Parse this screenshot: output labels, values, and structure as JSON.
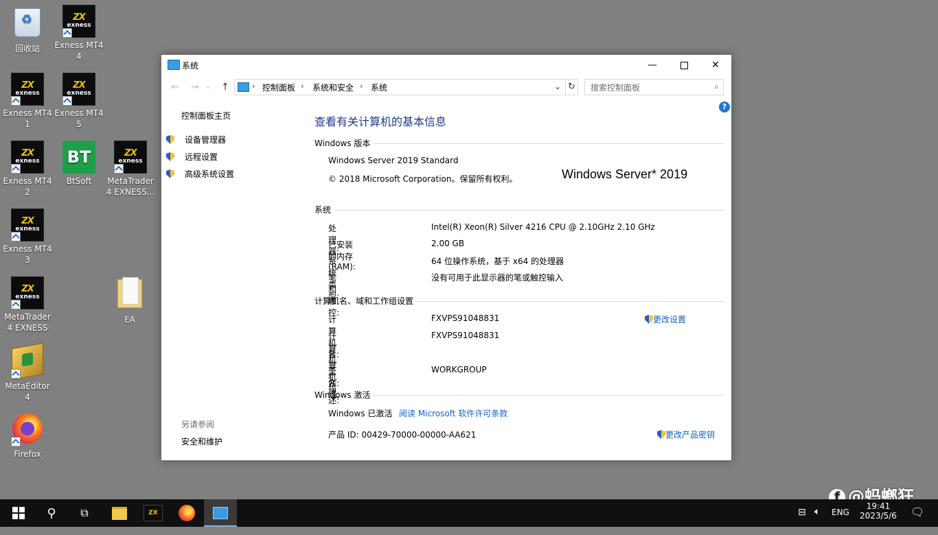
{
  "desktop": {
    "icons": [
      {
        "label": "回收站"
      },
      {
        "label": "Exness MT4 4"
      },
      {
        "label": "Exness MT4 1"
      },
      {
        "label": "Exness MT4 5"
      },
      {
        "label": "Exness MT4 2"
      },
      {
        "label": "BtSoft"
      },
      {
        "label": "MetaTrader 4 EXNESS..."
      },
      {
        "label": "Exness MT4 3"
      },
      {
        "label": "MetaTrader 4 EXNESS"
      },
      {
        "label": "EA"
      },
      {
        "label": "MetaEditor 4"
      },
      {
        "label": "Firefox"
      }
    ],
    "exness_logo_text": "exness",
    "exness_logo_mark": "ZX",
    "bt_logo_text": "BT"
  },
  "window": {
    "title": "系统",
    "controls": {
      "minimize": "—",
      "close": "✕"
    },
    "address": {
      "crumbs": [
        "控制面板",
        "系统和安全",
        "系统"
      ],
      "separator": "›",
      "search_placeholder": "搜索控制面板"
    },
    "help": "?",
    "left_nav": {
      "home": "控制面板主页",
      "items": [
        "设备管理器",
        "远程设置",
        "高级系统设置"
      ],
      "see_also": "另请参阅",
      "see_also_items": [
        "安全和维护"
      ]
    },
    "main": {
      "heading": "查看有关计算机的基本信息",
      "edition": {
        "header": "Windows 版本",
        "name": "Windows Server 2019 Standard",
        "copyright": "© 2018 Microsoft Corporation。保留所有权利。",
        "logo": "Windows Server* 2019"
      },
      "system": {
        "header": "系统",
        "rows": [
          {
            "k": "处理器:",
            "v": "Intel(R) Xeon(R) Silver 4216 CPU @ 2.10GHz   2.10 GHz"
          },
          {
            "k": "已安装的内存(RAM):",
            "v": "2.00 GB"
          },
          {
            "k": "系统类型:",
            "v": "64 位操作系统，基于 x64 的处理器"
          },
          {
            "k": "笔和触控:",
            "v": "没有可用于此显示器的笔或触控输入"
          }
        ]
      },
      "computer": {
        "header": "计算机名、域和工作组设置",
        "change_link": "更改设置",
        "rows": [
          {
            "k": "计算机名:",
            "v": "FXVPS91048831"
          },
          {
            "k": "计算机全名:",
            "v": "FXVPS91048831"
          },
          {
            "k": "计算机描述:",
            "v": ""
          },
          {
            "k": "工作组:",
            "v": "WORKGROUP"
          }
        ]
      },
      "activation": {
        "header": "Windows 激活",
        "status": "Windows 已激活",
        "license_link": "阅读 Microsoft 软件许可条款",
        "product_id": "产品 ID: 00429-70000-00000-AA621",
        "change_key_link": "更改产品密钥"
      }
    }
  },
  "taskbar": {
    "lang": "ENG",
    "time": "19:41",
    "date": "2023/5/6",
    "watermark": "@蚂螂狂",
    "watermark_mark": "f"
  }
}
